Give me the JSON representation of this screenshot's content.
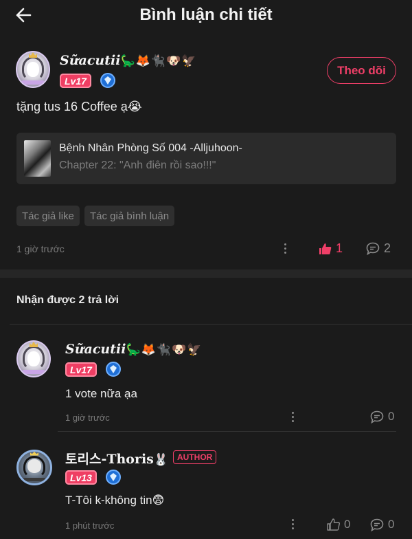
{
  "header": {
    "title": "Bình luận chi tiết",
    "back_icon": "arrow-left-icon"
  },
  "comment": {
    "username": "Sữacutii",
    "username_emojis": "🦕🦊🐈‍⬛🐶🦅",
    "level": "Lv17",
    "follow_label": "Theo dõi",
    "text": "tặng tus 16 Coffee ạ😭",
    "story": {
      "title": "Bệnh Nhân Phòng Số 004 -Alljuhoon-",
      "chapter": "Chapter 22: \"Anh điên rồi sao!!!\""
    },
    "tags": [
      "Tác giả like",
      "Tác giả bình luận"
    ],
    "time": "1 giờ trước",
    "likes": "1",
    "replies": "2"
  },
  "replies_header": "Nhận được 2 trả lời",
  "replies": [
    {
      "username": "Sữacutii",
      "username_emojis": "🦕🦊🐈‍⬛🐶🦅",
      "level": "Lv17",
      "text": "1 vote nữa ạa",
      "time": "1 giờ trước",
      "replies": "0"
    },
    {
      "username": "토리스-Thoris",
      "username_emojis": "🐰",
      "badge": "AUTHOR",
      "level": "Lv13",
      "text": "T-Tôi k-không tin😨",
      "time": "1 phút trước",
      "likes": "0",
      "replies": "0"
    }
  ],
  "colors": {
    "accent": "#f03f68",
    "background": "#1b1b1b",
    "card": "#2b2b2b"
  }
}
